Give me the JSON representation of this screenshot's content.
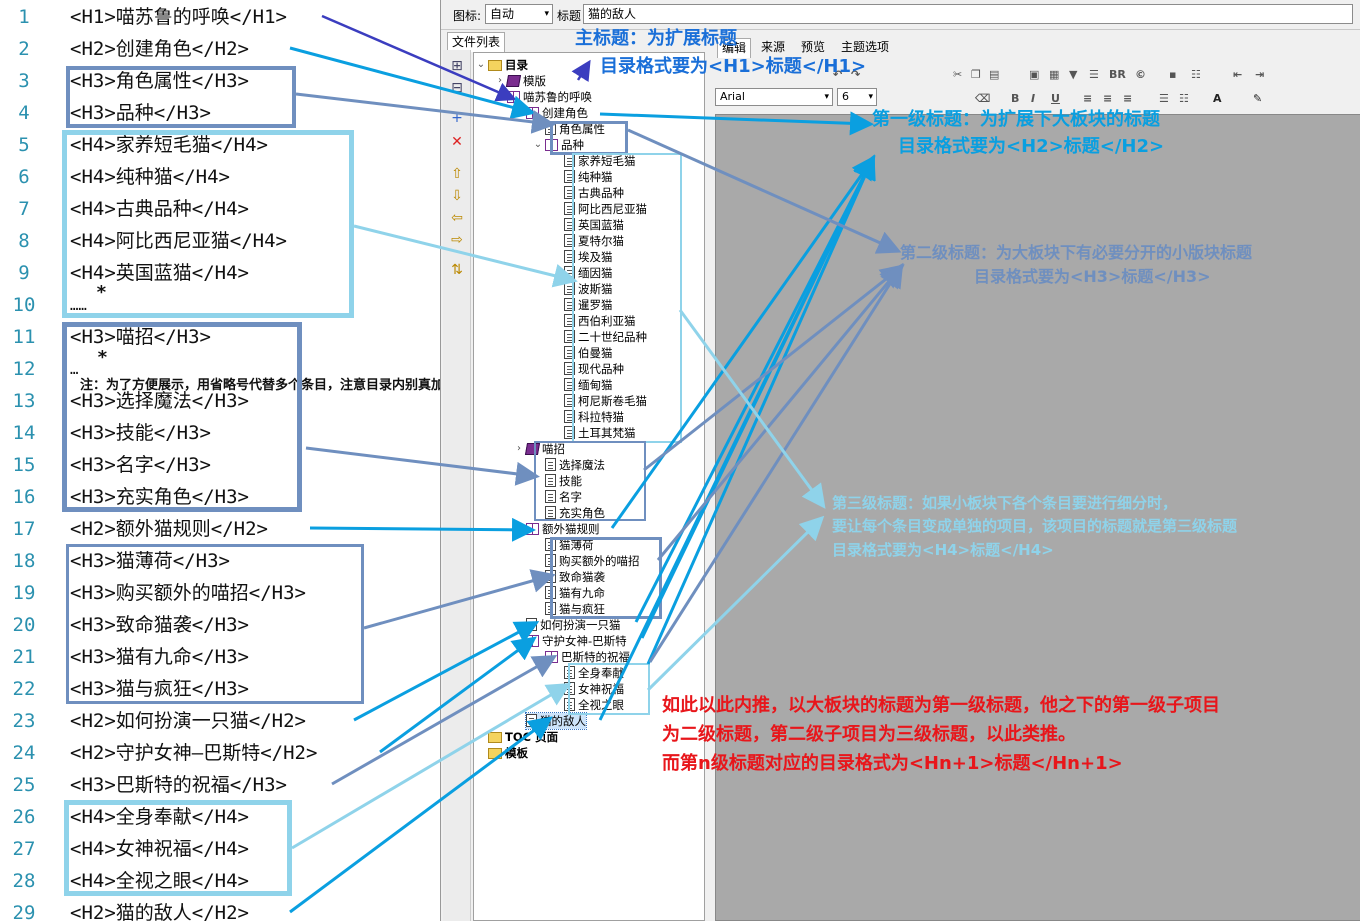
{
  "code_lines": [
    {
      "n": "1",
      "t": "<H1>喵苏鲁的呼唤</H1>"
    },
    {
      "n": "2",
      "t": "<H2>创建角色</H2>"
    },
    {
      "n": "3",
      "t": "<H3>角色属性</H3>"
    },
    {
      "n": "4",
      "t": "<H3>品种</H3>"
    },
    {
      "n": "5",
      "t": "<H4>家养短毛猫</H4>"
    },
    {
      "n": "6",
      "t": "<H4>纯种猫</H4>"
    },
    {
      "n": "7",
      "t": "<H4>古典品种</H4>"
    },
    {
      "n": "8",
      "t": "<H4>阿比西尼亚猫</H4>"
    },
    {
      "n": "9",
      "t": "<H4>英国蓝猫</H4>"
    },
    {
      "n": "10",
      "t": "……"
    },
    {
      "n": "11",
      "t": "<H3>喵招</H3>"
    },
    {
      "n": "12",
      "t": "…"
    },
    {
      "n": "13",
      "t": "<H3>选择魔法</H3>"
    },
    {
      "n": "14",
      "t": "<H3>技能</H3>"
    },
    {
      "n": "15",
      "t": "<H3>名字</H3>"
    },
    {
      "n": "16",
      "t": "<H3>充实角色</H3>"
    },
    {
      "n": "17",
      "t": "<H2>额外猫规则</H2>"
    },
    {
      "n": "18",
      "t": "<H3>猫薄荷</H3>"
    },
    {
      "n": "19",
      "t": "<H3>购买额外的喵招</H3>"
    },
    {
      "n": "20",
      "t": "<H3>致命猫袭</H3>"
    },
    {
      "n": "21",
      "t": "<H3>猫有九命</H3>"
    },
    {
      "n": "22",
      "t": "<H3>猫与疯狂</H3>"
    },
    {
      "n": "23",
      "t": "<H2>如何扮演一只猫</H2>"
    },
    {
      "n": "24",
      "t": "<H2>守护女神—巴斯特</H2>"
    },
    {
      "n": "25",
      "t": "<H3>巴斯特的祝福</H3>"
    },
    {
      "n": "26",
      "t": "<H4>全身奉献</H4>"
    },
    {
      "n": "27",
      "t": "<H4>女神祝福</H4>"
    },
    {
      "n": "28",
      "t": "<H4>全视之眼</H4>"
    },
    {
      "n": "29",
      "t": "<H2>猫的敌人</H2>"
    }
  ],
  "code_note": "注：为了方便展示，用省略号代替多个条目，注意目录内别真加省略号",
  "toolbar": {
    "icon_label": "图标:",
    "icon_value": "自动",
    "title_label": "标题",
    "title_value": "猫的敌人"
  },
  "panel_tab": "文件列表",
  "editor_tabs": [
    "编辑",
    "来源",
    "预览",
    "主题选项"
  ],
  "font_name": "Arial",
  "font_size": "6",
  "tree": [
    {
      "t": "目录",
      "lv": 0,
      "ic": "folder",
      "tw": "v"
    },
    {
      "t": "模版",
      "lv": 1,
      "ic": "book",
      "tw": ">"
    },
    {
      "t": "喵苏鲁的呼唤",
      "lv": 1,
      "ic": "open",
      "tw": "v"
    },
    {
      "t": "创建角色",
      "lv": 2,
      "ic": "open",
      "tw": "v"
    },
    {
      "t": "角色属性",
      "lv": 3,
      "ic": "page",
      "tw": ""
    },
    {
      "t": "品种",
      "lv": 3,
      "ic": "open",
      "tw": "v"
    },
    {
      "t": "家养短毛猫",
      "lv": 4,
      "ic": "page",
      "tw": ""
    },
    {
      "t": "纯种猫",
      "lv": 4,
      "ic": "page",
      "tw": ""
    },
    {
      "t": "古典品种",
      "lv": 4,
      "ic": "page",
      "tw": ""
    },
    {
      "t": "阿比西尼亚猫",
      "lv": 4,
      "ic": "page",
      "tw": ""
    },
    {
      "t": "英国蓝猫",
      "lv": 4,
      "ic": "page",
      "tw": ""
    },
    {
      "t": "夏特尔猫",
      "lv": 4,
      "ic": "page",
      "tw": ""
    },
    {
      "t": "埃及猫",
      "lv": 4,
      "ic": "page",
      "tw": ""
    },
    {
      "t": "缅因猫",
      "lv": 4,
      "ic": "page",
      "tw": ""
    },
    {
      "t": "波斯猫",
      "lv": 4,
      "ic": "page",
      "tw": ""
    },
    {
      "t": "暹罗猫",
      "lv": 4,
      "ic": "page",
      "tw": ""
    },
    {
      "t": "西伯利亚猫",
      "lv": 4,
      "ic": "page",
      "tw": ""
    },
    {
      "t": "二十世纪品种",
      "lv": 4,
      "ic": "page",
      "tw": ""
    },
    {
      "t": "伯曼猫",
      "lv": 4,
      "ic": "page",
      "tw": ""
    },
    {
      "t": "现代品种",
      "lv": 4,
      "ic": "page",
      "tw": ""
    },
    {
      "t": "缅甸猫",
      "lv": 4,
      "ic": "page",
      "tw": ""
    },
    {
      "t": "柯尼斯卷毛猫",
      "lv": 4,
      "ic": "page",
      "tw": ""
    },
    {
      "t": "科拉特猫",
      "lv": 4,
      "ic": "page",
      "tw": ""
    },
    {
      "t": "土耳其梵猫",
      "lv": 4,
      "ic": "page",
      "tw": ""
    },
    {
      "t": "喵招",
      "lv": 2,
      "ic": "book",
      "tw": ">"
    },
    {
      "t": "选择魔法",
      "lv": 3,
      "ic": "page",
      "tw": ""
    },
    {
      "t": "技能",
      "lv": 3,
      "ic": "page",
      "tw": ""
    },
    {
      "t": "名字",
      "lv": 3,
      "ic": "page",
      "tw": ""
    },
    {
      "t": "充实角色",
      "lv": 3,
      "ic": "page",
      "tw": ""
    },
    {
      "t": "额外猫规则",
      "lv": 2,
      "ic": "open",
      "tw": "v"
    },
    {
      "t": "猫薄荷",
      "lv": 3,
      "ic": "page",
      "tw": ""
    },
    {
      "t": "购买额外的喵招",
      "lv": 3,
      "ic": "page",
      "tw": ""
    },
    {
      "t": "致命猫袭",
      "lv": 3,
      "ic": "page",
      "tw": ""
    },
    {
      "t": "猫有九命",
      "lv": 3,
      "ic": "page",
      "tw": ""
    },
    {
      "t": "猫与疯狂",
      "lv": 3,
      "ic": "page",
      "tw": ""
    },
    {
      "t": "如何扮演一只猫",
      "lv": 2,
      "ic": "page",
      "tw": ""
    },
    {
      "t": "守护女神-巴斯特",
      "lv": 2,
      "ic": "open",
      "tw": "v"
    },
    {
      "t": "巴斯特的祝福",
      "lv": 3,
      "ic": "open",
      "tw": "v"
    },
    {
      "t": "全身奉献",
      "lv": 4,
      "ic": "page",
      "tw": ""
    },
    {
      "t": "女神祝福",
      "lv": 4,
      "ic": "page",
      "tw": ""
    },
    {
      "t": "全视之眼",
      "lv": 4,
      "ic": "page",
      "tw": ""
    },
    {
      "t": "猫的敌人",
      "lv": 2,
      "ic": "page",
      "tw": "",
      "sel": true
    },
    {
      "t": "TOC 页面",
      "lv": 0,
      "ic": "folder",
      "tw": ""
    },
    {
      "t": "模板",
      "lv": 0,
      "ic": "folder",
      "tw": ""
    }
  ],
  "annotations": {
    "main_title_1": "主标题：为扩展标题",
    "main_title_2": "目录格式要为<H1>标题</H1>",
    "level1_1": "第一级标题：为扩展下大板块的标题",
    "level1_2": "目录格式要为<H2>标题</H2>",
    "level2_1": "第二级标题：为大板块下有必要分开的小版块标题",
    "level2_2": "目录格式要为<H3>标题</H3>",
    "level3_1": "第三级标题：如果小板块下各个条目要进行细分时，",
    "level3_2": "要让每个条目变成单独的项目，该项目的标题就是第三级标题",
    "level3_3": "目录格式要为<H4>标题</H4>",
    "summary_1": "如此以此内推，以大板块的标题为第一级标题，他之下的第一级子项目",
    "summary_2": "为二级标题，第二级子项目为三级标题，以此类推。",
    "summary_3": "而第n级标题对应的目录格式为<Hn+1>标题</Hn+1>"
  },
  "colors": {
    "h1": "#3b3dbf",
    "h2": "#0a9fe0",
    "h3": "#6f8fbf",
    "h4": "#8fd3ea",
    "summary": "#e8161b",
    "line_no": "#2b91af"
  }
}
